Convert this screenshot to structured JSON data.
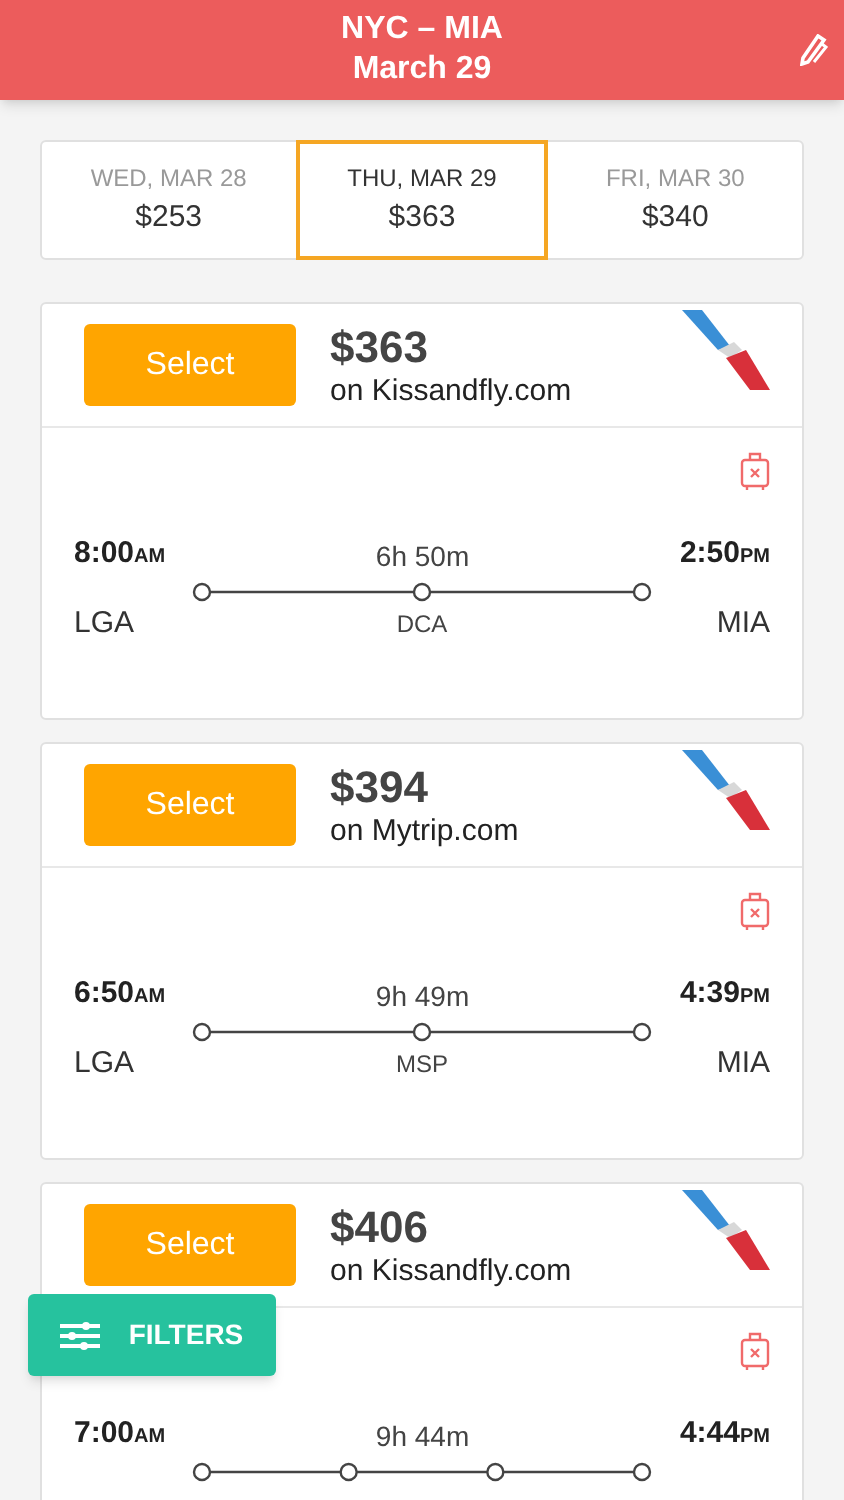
{
  "header": {
    "route": "NYC – MIA",
    "date": "March 29"
  },
  "dates": [
    {
      "day": "WED, MAR 28",
      "price": "$253",
      "selected": false
    },
    {
      "day": "THU, MAR 29",
      "price": "$363",
      "selected": true
    },
    {
      "day": "FRI, MAR 30",
      "price": "$340",
      "selected": false
    }
  ],
  "flights": [
    {
      "button": "Select",
      "price": "$363",
      "site": "on Kissandfly.com",
      "depart_time": "8:00",
      "depart_period": "AM",
      "duration": "6h 50m",
      "arrive_time": "2:50",
      "arrive_period": "PM",
      "depart_code": "LGA",
      "arrive_code": "MIA",
      "stops": [
        {
          "kind": "layover",
          "code": "DCA"
        }
      ]
    },
    {
      "button": "Select",
      "price": "$394",
      "site": "on Mytrip.com",
      "depart_time": "6:50",
      "depart_period": "AM",
      "duration": "9h 49m",
      "arrive_time": "4:39",
      "arrive_period": "PM",
      "depart_code": "LGA",
      "arrive_code": "MIA",
      "stops": [
        {
          "kind": "layover",
          "code": "MSP"
        }
      ]
    },
    {
      "button": "Select",
      "price": "$406",
      "site": "on Kissandfly.com",
      "depart_time": "7:00",
      "depart_period": "AM",
      "duration": "9h 44m",
      "arrive_time": "4:44",
      "arrive_period": "PM",
      "stops": [
        {
          "kind": "layover"
        },
        {
          "kind": "layover"
        }
      ]
    }
  ],
  "filters_button": "FILTERS"
}
